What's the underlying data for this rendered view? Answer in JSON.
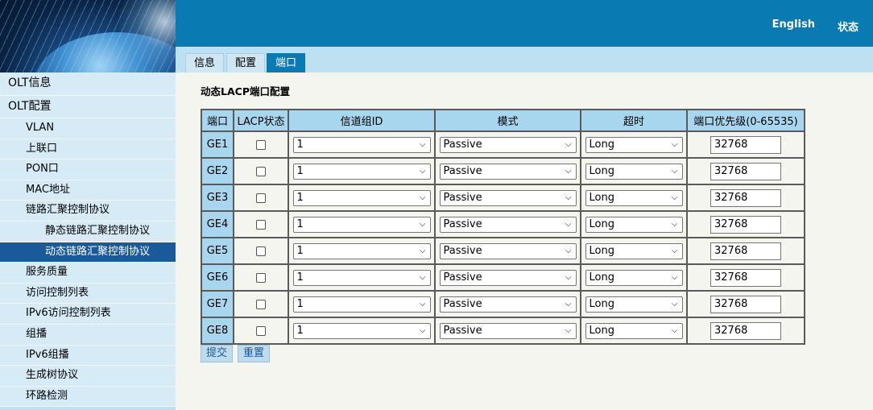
{
  "header": {
    "links": [
      "English",
      "状态"
    ]
  },
  "tabs": [
    {
      "label": "信息"
    },
    {
      "label": "配置"
    },
    {
      "label": "端口",
      "active": true
    }
  ],
  "sidebar": {
    "items": [
      {
        "label": "OLT信息",
        "level": 0
      },
      {
        "label": "OLT配置",
        "level": 0
      },
      {
        "label": "VLAN",
        "level": 1
      },
      {
        "label": "上联口",
        "level": 1
      },
      {
        "label": "PON口",
        "level": 1
      },
      {
        "label": "MAC地址",
        "level": 1
      },
      {
        "label": "链路汇聚控制协议",
        "level": 1
      },
      {
        "label": "静态链路汇聚控制协议",
        "level": 2
      },
      {
        "label": "动态链路汇聚控制协议",
        "level": 2,
        "active": true
      },
      {
        "label": "服务质量",
        "level": 1
      },
      {
        "label": "访问控制列表",
        "level": 1
      },
      {
        "label": "IPv6访问控制列表",
        "level": 1
      },
      {
        "label": "组播",
        "level": 1
      },
      {
        "label": "IPv6组播",
        "level": 1
      },
      {
        "label": "生成树协议",
        "level": 1
      },
      {
        "label": "环路检测",
        "level": 1
      }
    ]
  },
  "main": {
    "title": "动态LACP端口配置",
    "columns": [
      "端口",
      "LACP状态",
      "信道组ID",
      "模式",
      "超时",
      "端口优先级(0-65535)"
    ],
    "rows": [
      {
        "port": "GE1",
        "lacp": false,
        "group": "1",
        "mode": "Passive",
        "timeout": "Long",
        "priority": "32768"
      },
      {
        "port": "GE2",
        "lacp": false,
        "group": "1",
        "mode": "Passive",
        "timeout": "Long",
        "priority": "32768"
      },
      {
        "port": "GE3",
        "lacp": false,
        "group": "1",
        "mode": "Passive",
        "timeout": "Long",
        "priority": "32768"
      },
      {
        "port": "GE4",
        "lacp": false,
        "group": "1",
        "mode": "Passive",
        "timeout": "Long",
        "priority": "32768"
      },
      {
        "port": "GE5",
        "lacp": false,
        "group": "1",
        "mode": "Passive",
        "timeout": "Long",
        "priority": "32768"
      },
      {
        "port": "GE6",
        "lacp": false,
        "group": "1",
        "mode": "Passive",
        "timeout": "Long",
        "priority": "32768"
      },
      {
        "port": "GE7",
        "lacp": false,
        "group": "1",
        "mode": "Passive",
        "timeout": "Long",
        "priority": "32768"
      },
      {
        "port": "GE8",
        "lacp": false,
        "group": "1",
        "mode": "Passive",
        "timeout": "Long",
        "priority": "32768"
      }
    ],
    "buttons": {
      "submit": "提交",
      "reset": "重置"
    }
  },
  "colors": {
    "header_bg": "#0a7ab3",
    "nav_bg": "#d6ebf6",
    "nav_active": "#1a5a9a",
    "table_header": "#a9d6ef"
  },
  "icons": {
    "dropdown": "chevron-down-icon"
  }
}
